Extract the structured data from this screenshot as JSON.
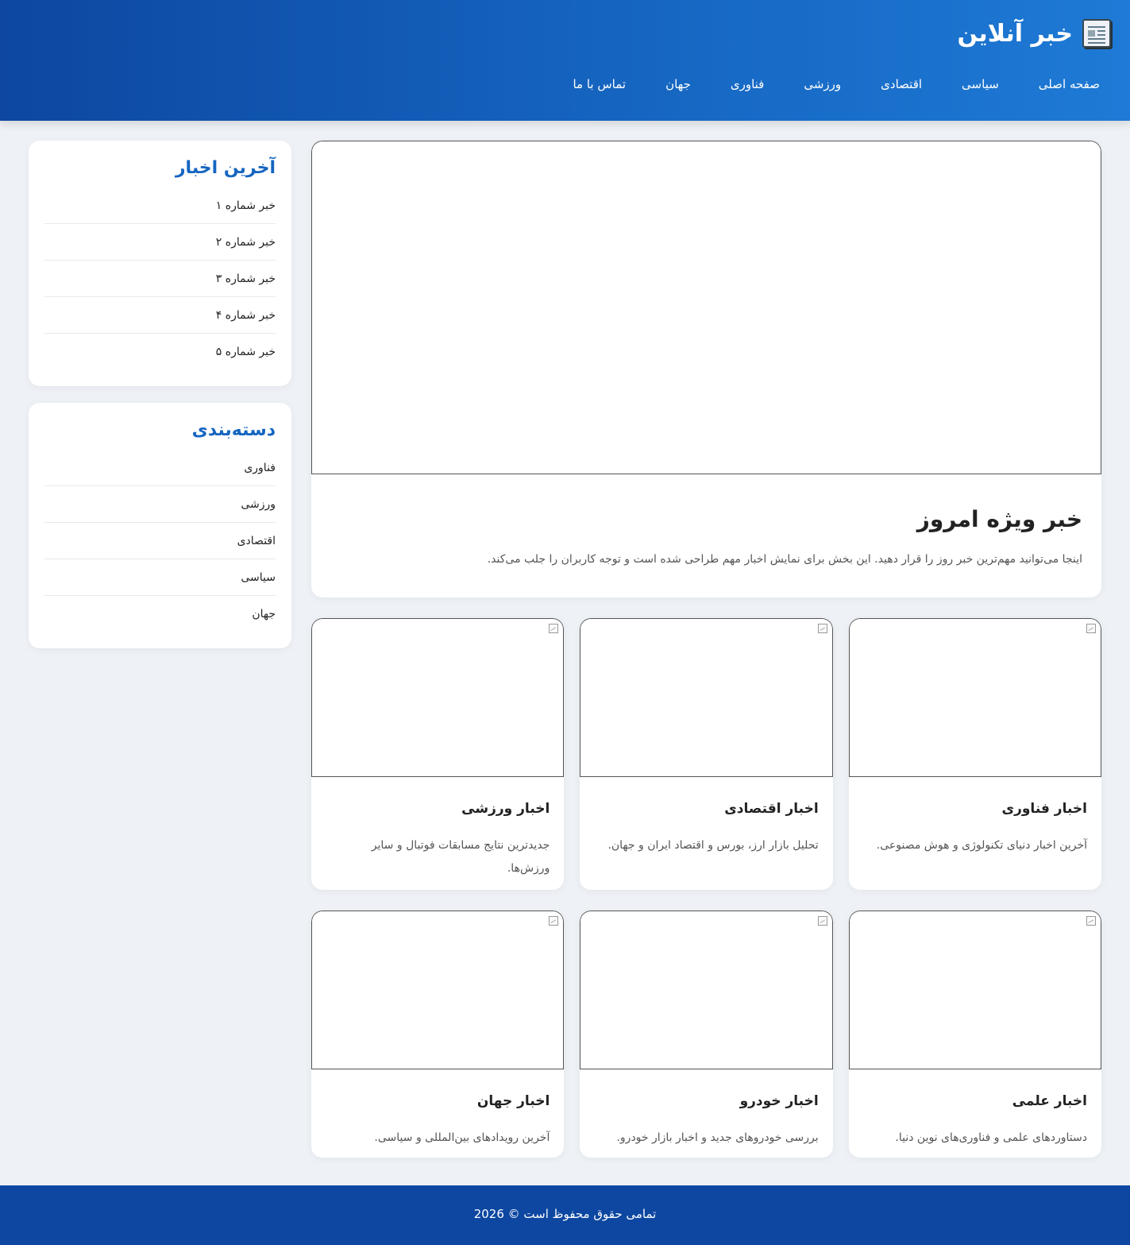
{
  "brand": {
    "title": "خبر آنلاین",
    "icon": "newspaper-icon"
  },
  "nav": [
    {
      "label": "صفحه اصلی"
    },
    {
      "label": "سیاسی"
    },
    {
      "label": "اقتصادی"
    },
    {
      "label": "ورزشی"
    },
    {
      "label": "فناوری"
    },
    {
      "label": "جهان"
    },
    {
      "label": "تماس با ما"
    }
  ],
  "featured": {
    "title": "خبر ویژه امروز",
    "text": "اینجا می‌توانید مهم‌ترین خبر روز را قرار دهید. این بخش برای نمایش اخبار مهم طراحی شده است و توجه کاربران را جلب می‌کند."
  },
  "cards": [
    {
      "title": "اخبار فناوری",
      "text": "آخرین اخبار دنیای تکنولوژی و هوش مصنوعی."
    },
    {
      "title": "اخبار اقتصادی",
      "text": "تحلیل بازار ارز، بورس و اقتصاد ایران و جهان."
    },
    {
      "title": "اخبار ورزشی",
      "text": "جدیدترین نتایج مسابقات فوتبال و سایر ورزش‌ها."
    },
    {
      "title": "اخبار علمی",
      "text": "دستاوردهای علمی و فناوری‌های نوین دنیا."
    },
    {
      "title": "اخبار خودرو",
      "text": "بررسی خودروهای جدید و اخبار بازار خودرو."
    },
    {
      "title": "اخبار جهان",
      "text": "آخرین رویدادهای بین‌المللی و سیاسی."
    }
  ],
  "sidebar": {
    "latest": {
      "title": "آخرین اخبار",
      "items": [
        "خبر شماره ۱",
        "خبر شماره ۲",
        "خبر شماره ۳",
        "خبر شماره ۴",
        "خبر شماره ۵"
      ]
    },
    "categories": {
      "title": "دسته‌بندی",
      "items": [
        "فناوری",
        "ورزشی",
        "اقتصادی",
        "سیاسی",
        "جهان"
      ]
    }
  },
  "footer": {
    "text": "تمامی حقوق محفوظ است © 2026"
  }
}
